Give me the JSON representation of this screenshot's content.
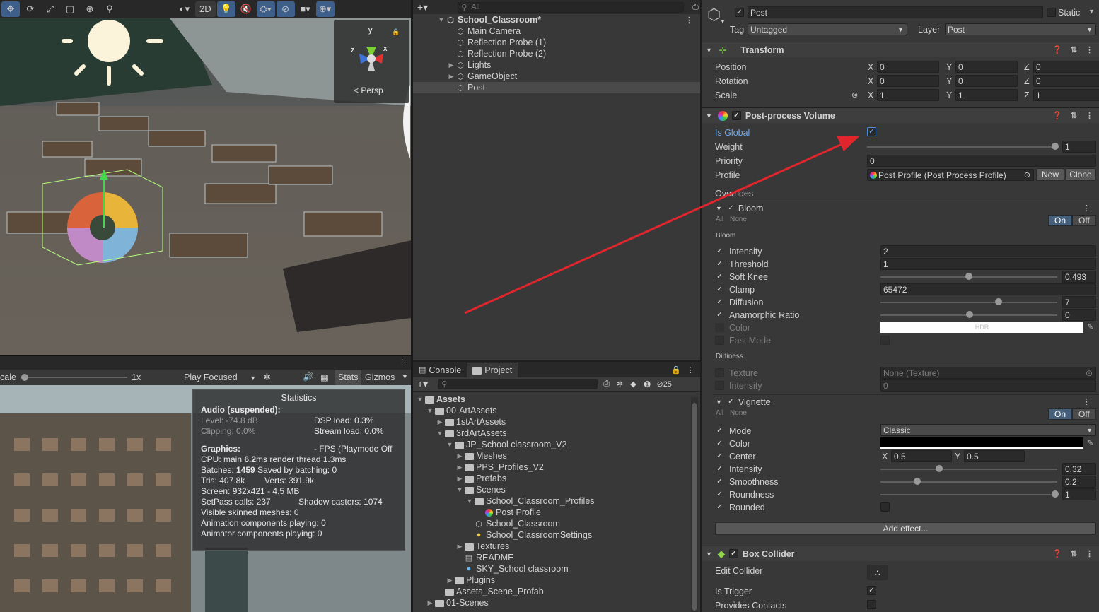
{
  "scene": {
    "toolbar_buttons": [
      "move-tool",
      "rotate-tool",
      "scale-tool",
      "rect-tool",
      "transform-tool",
      "custom-tool"
    ],
    "mode_2d": "2D",
    "gizmo_persp": "Persp",
    "axis_y": "y",
    "axis_x": "x",
    "axis_z": "z"
  },
  "game": {
    "scale_label": "cale",
    "scale_value": "1x",
    "play_mode": "Play Focused",
    "stats_label": "Stats",
    "gizmos_label": "Gizmos"
  },
  "stats": {
    "title": "Statistics",
    "audio_header": "Audio (suspended):",
    "level": "Level: -74.8 dB",
    "dsp": "DSP load: 0.3%",
    "clipping": "Clipping: 0.0%",
    "stream": "Stream load: 0.0%",
    "graphics_header": "Graphics:",
    "fps": "- FPS (Playmode Off",
    "cpu_pre": "CPU: main ",
    "cpu_main": "6.2",
    "cpu_post": "ms  render thread 1.3ms",
    "batches_pre": "Batches: ",
    "batches_val": "1459",
    "batches_post": "   Saved by batching: 0",
    "tris": "Tris: 407.8k",
    "verts": "Verts: 391.9k",
    "screen": "Screen: 932x421 - 4.5 MB",
    "setpass": "SetPass calls: 237",
    "shadow": "Shadow casters: 1074",
    "skinned": "Visible skinned meshes: 0",
    "anim": "Animation components playing: 0",
    "animator": "Animator components playing: 0"
  },
  "hierarchy": {
    "search_placeholder": "All",
    "scene_name": "School_Classroom*",
    "items": [
      "Main Camera",
      "Reflection Probe (1)",
      "Reflection Probe (2)",
      "Lights",
      "GameObject",
      "Post"
    ]
  },
  "project": {
    "tabs": [
      "Console",
      "Project"
    ],
    "hidden_count": "25",
    "tree": [
      {
        "label": "Assets",
        "depth": 0,
        "arrow": "▼",
        "bold": true
      },
      {
        "label": "00-ArtAssets",
        "depth": 1,
        "arrow": "▼"
      },
      {
        "label": "1stArtAssets",
        "depth": 2,
        "arrow": "▶"
      },
      {
        "label": "3rdArtAssets",
        "depth": 2,
        "arrow": "▼"
      },
      {
        "label": "JP_School classroom_V2",
        "depth": 3,
        "arrow": "▼"
      },
      {
        "label": "Meshes",
        "depth": 4,
        "arrow": "▶"
      },
      {
        "label": "PPS_Profiles_V2",
        "depth": 4,
        "arrow": "▶"
      },
      {
        "label": "Prefabs",
        "depth": 4,
        "arrow": "▶"
      },
      {
        "label": "Scenes",
        "depth": 4,
        "arrow": "▼"
      },
      {
        "label": "School_Classroom_Profiles",
        "depth": 5,
        "arrow": "▼"
      },
      {
        "label": "Post Profile",
        "depth": 6,
        "arrow": "",
        "icon": "profile"
      },
      {
        "label": "School_Classroom",
        "depth": 5,
        "arrow": "",
        "icon": "unity"
      },
      {
        "label": "School_ClassroomSettings",
        "depth": 5,
        "arrow": "",
        "icon": "settings"
      },
      {
        "label": "Textures",
        "depth": 4,
        "arrow": "▶"
      },
      {
        "label": "README",
        "depth": 4,
        "arrow": "",
        "icon": "doc"
      },
      {
        "label": "SKY_School classroom",
        "depth": 4,
        "arrow": "",
        "icon": "sky"
      },
      {
        "label": "Plugins",
        "depth": 3,
        "arrow": "▶"
      },
      {
        "label": "Assets_Scene_Profab",
        "depth": 2,
        "arrow": ""
      },
      {
        "label": "01-Scenes",
        "depth": 1,
        "arrow": "▶"
      }
    ]
  },
  "inspector": {
    "name": "Post",
    "static_label": "Static",
    "tag_label": "Tag",
    "tag_value": "Untagged",
    "layer_label": "Layer",
    "layer_value": "Post",
    "transform": {
      "title": "Transform",
      "rows": [
        {
          "label": "Position",
          "x": "0",
          "y": "0",
          "z": "0"
        },
        {
          "label": "Rotation",
          "x": "0",
          "y": "0",
          "z": "0"
        },
        {
          "label": "Scale",
          "x": "1",
          "y": "1",
          "z": "1"
        }
      ]
    },
    "ppv": {
      "title": "Post-process Volume",
      "is_global": "Is Global",
      "weight_label": "Weight",
      "weight_value": "1",
      "priority_label": "Priority",
      "priority_value": "0",
      "profile_label": "Profile",
      "profile_value": "Post Profile (Post Process Profile)",
      "new_btn": "New",
      "clone_btn": "Clone",
      "overrides": "Overrides"
    },
    "bloom": {
      "title": "Bloom",
      "all": "All",
      "none": "None",
      "on": "On",
      "off": "Off",
      "section": "Bloom",
      "intensity": "Intensity",
      "intensity_val": "2",
      "threshold": "Threshold",
      "threshold_val": "1",
      "softknee": "Soft Knee",
      "softknee_val": "0.493",
      "clamp": "Clamp",
      "clamp_val": "65472",
      "diffusion": "Diffusion",
      "diffusion_val": "7",
      "anamorphic": "Anamorphic Ratio",
      "anamorphic_val": "0",
      "color": "Color",
      "color_hdr": "HDR",
      "fastmode": "Fast Mode",
      "dirtiness": "Dirtiness",
      "texture": "Texture",
      "texture_val": "None (Texture)",
      "dirt_intensity": "Intensity",
      "dirt_intensity_val": "0"
    },
    "vignette": {
      "title": "Vignette",
      "all": "All",
      "none": "None",
      "on": "On",
      "off": "Off",
      "mode": "Mode",
      "mode_val": "Classic",
      "color": "Color",
      "center": "Center",
      "center_x": "0.5",
      "center_y": "0.5",
      "intensity": "Intensity",
      "intensity_val": "0.32",
      "smoothness": "Smoothness",
      "smoothness_val": "0.2",
      "roundness": "Roundness",
      "roundness_val": "1",
      "rounded": "Rounded"
    },
    "add_effect": "Add effect...",
    "boxcollider": {
      "title": "Box Collider",
      "edit": "Edit Collider",
      "trigger": "Is Trigger",
      "contacts": "Provides Contacts"
    }
  },
  "colors": {
    "arrow": "#e0262c",
    "accent": "#4a8ad6",
    "link": "#6ea8e8"
  }
}
